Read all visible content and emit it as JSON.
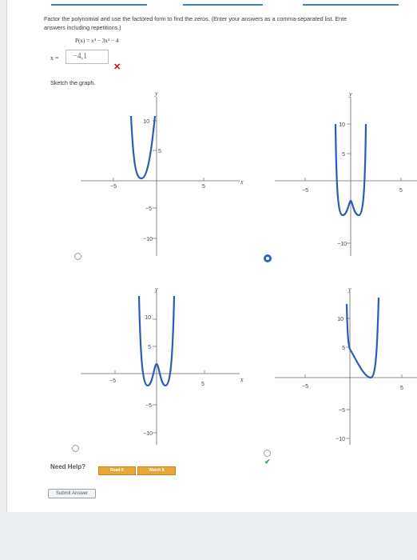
{
  "question": {
    "instruction_line1": "Factor the polynomial and use the factored form to find the zeros. (Enter your answers as a comma-separated list. Ente",
    "instruction_line2": "answers including repetitions.)",
    "polynomial": "P(x) = x⁴ − 3x² − 4",
    "answer_label": "x =",
    "answer_value": "−4,1",
    "answer_status": "incorrect"
  },
  "sketch": {
    "label": "Sketch the graph.",
    "graphs": [
      {
        "ytick_labels": [
          "10",
          "5",
          "−5",
          "−10"
        ],
        "xtick_labels": [
          "−5",
          "5"
        ],
        "x_axis_label": "x",
        "y_axis_label": "y"
      },
      {
        "ytick_labels": [
          "10",
          "5",
          "−10"
        ],
        "xtick_labels": [
          "−5",
          "5"
        ],
        "y_axis_label": "y"
      },
      {
        "ytick_labels": [
          "10",
          "5",
          "−5",
          "−10"
        ],
        "xtick_labels": [
          "−5",
          "5"
        ],
        "x_axis_label": "x",
        "y_axis_label": "y"
      },
      {
        "ytick_labels": [
          "10",
          "5",
          "−5",
          "−10"
        ],
        "xtick_labels": [
          "−5",
          "5"
        ],
        "y_axis_label": "y"
      }
    ],
    "selected_option": 2
  },
  "help": {
    "label": "Need Help?",
    "read_label": "Read It",
    "watch_label": "Watch It"
  },
  "submit_label": "Submit Answer",
  "colors": {
    "curve": "#2f5bb7",
    "selected_radio": "#2b63c6",
    "wrong": "#d0021b",
    "help_button": "#e8a53a"
  }
}
